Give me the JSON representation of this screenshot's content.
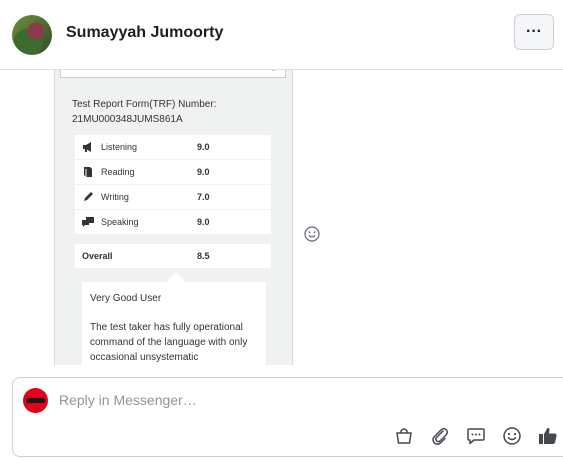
{
  "header": {
    "contact_name": "Sumayyah Jumoorty",
    "more_label": "···"
  },
  "attachment": {
    "trf_label": "Test Report Form(TRF) Number:",
    "trf_number": "21MU000348JUMS861A",
    "scores": [
      {
        "label": "Listening",
        "value": "9.0",
        "icon": "megaphone-icon"
      },
      {
        "label": "Reading",
        "value": "9.0",
        "icon": "book-icon"
      },
      {
        "label": "Writing",
        "value": "7.0",
        "icon": "pen-icon"
      },
      {
        "label": "Speaking",
        "value": "9.0",
        "icon": "speech-bubbles-icon"
      }
    ],
    "overall_label": "Overall",
    "overall_value": "8.5",
    "band_title": "Very Good User",
    "band_description": "The test taker has fully operational command of the language with only occasional unsystematic"
  },
  "reply": {
    "placeholder": "Reply in Messenger…",
    "tools": [
      "shop-bag-icon",
      "paperclip-icon",
      "comment-icon",
      "smiley-icon",
      "thumbs-up-icon"
    ]
  },
  "colors": {
    "accent": "#1c1e21",
    "page_avatar": "#e3001b",
    "border": "#ccd0d5"
  }
}
